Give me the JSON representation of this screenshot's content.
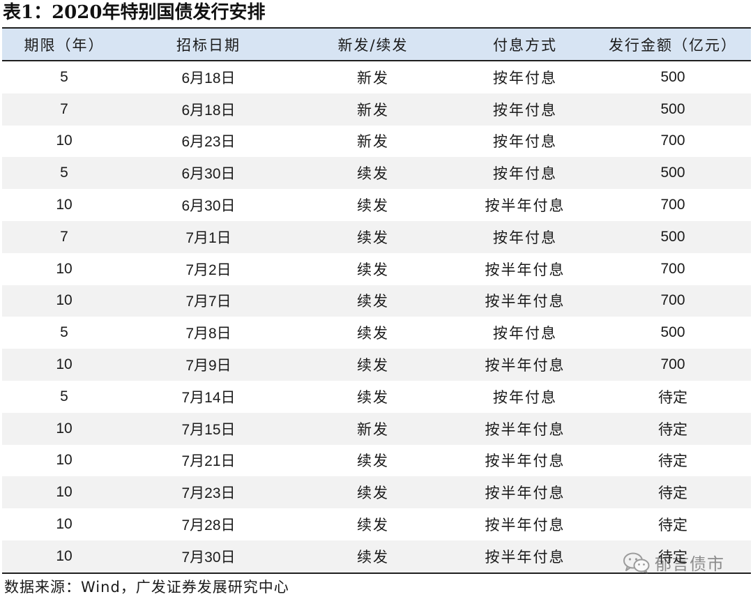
{
  "title": "表1：2020年特别国债发行安排",
  "table": {
    "headers": [
      "期限（年）",
      "招标日期",
      "新发/续发",
      "付息方式",
      "发行金额（亿元）"
    ],
    "rows": [
      [
        "5",
        "6月18日",
        "新发",
        "按年付息",
        "500"
      ],
      [
        "7",
        "6月18日",
        "新发",
        "按年付息",
        "500"
      ],
      [
        "10",
        "6月23日",
        "新发",
        "按年付息",
        "700"
      ],
      [
        "5",
        "6月30日",
        "续发",
        "按年付息",
        "500"
      ],
      [
        "10",
        "6月30日",
        "续发",
        "按半年付息",
        "700"
      ],
      [
        "7",
        "7月1日",
        "续发",
        "按年付息",
        "500"
      ],
      [
        "10",
        "7月2日",
        "续发",
        "按半年付息",
        "700"
      ],
      [
        "10",
        "7月7日",
        "续发",
        "按半年付息",
        "700"
      ],
      [
        "5",
        "7月8日",
        "续发",
        "按年付息",
        "500"
      ],
      [
        "10",
        "7月9日",
        "续发",
        "按半年付息",
        "700"
      ],
      [
        "5",
        "7月14日",
        "续发",
        "按年付息",
        "待定"
      ],
      [
        "10",
        "7月15日",
        "新发",
        "按半年付息",
        "待定"
      ],
      [
        "10",
        "7月21日",
        "续发",
        "按半年付息",
        "待定"
      ],
      [
        "10",
        "7月23日",
        "续发",
        "按半年付息",
        "待定"
      ],
      [
        "10",
        "7月28日",
        "续发",
        "按半年付息",
        "待定"
      ],
      [
        "10",
        "7月30日",
        "续发",
        "按半年付息",
        "待定"
      ]
    ]
  },
  "source": "数据来源：Wind，广发证券发展研究中心",
  "watermark": {
    "icon": "wechat-icon",
    "text": "郁言债市"
  },
  "colors": {
    "header_bg": "#d7e4f3",
    "stripe_bg": "#f2f2f2",
    "rule": "#1f1f1f"
  }
}
